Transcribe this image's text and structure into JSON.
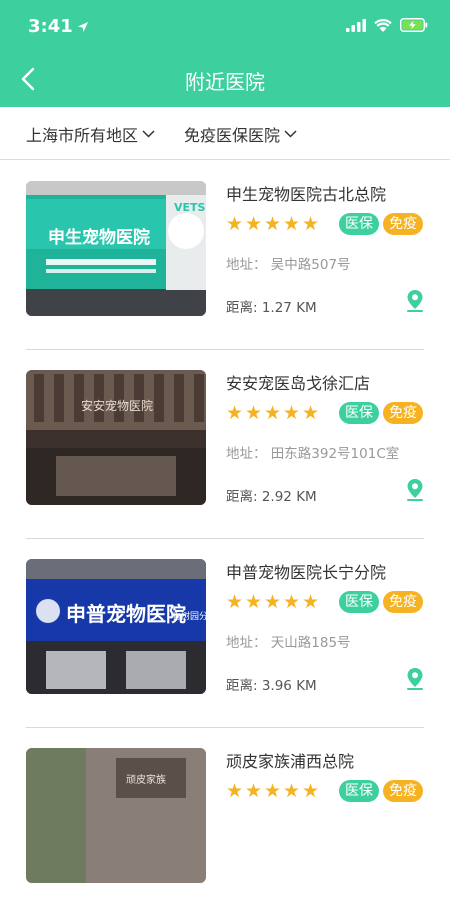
{
  "status_bar": {
    "time": "3:41"
  },
  "nav": {
    "title": "附近医院"
  },
  "filters": [
    {
      "label": "上海市所有地区"
    },
    {
      "label": "免疫医保医院"
    }
  ],
  "colors": {
    "accent": "#3ecf9f",
    "star": "#f5b324"
  },
  "hospitals": [
    {
      "name": "申生宠物医院古北总院",
      "rating": 5,
      "badges": [
        "医保",
        "免疫"
      ],
      "address": "地址：  吴中路507号",
      "distance": "距离: 1.27 KM",
      "sign_text": "申生宠物医院",
      "sign_text2": "VETS"
    },
    {
      "name": "安安宠医岛戈徐汇店",
      "rating": 5,
      "badges": [
        "医保",
        "免疫"
      ],
      "address": "地址：  田东路392号101C室",
      "distance": "距离: 2.92 KM",
      "sign_text": "安安宠物医院"
    },
    {
      "name": "申普宠物医院长宁分院",
      "rating": 5,
      "badges": [
        "医保",
        "免疫"
      ],
      "address": "地址：  天山路185号",
      "distance": "距离: 3.96 KM",
      "sign_text": "申普宠物医院",
      "sign_text2": "香树园分院"
    },
    {
      "name": "顽皮家族浦西总院",
      "rating": 5,
      "badges": [
        "医保",
        "免疫"
      ],
      "address": "",
      "distance": "",
      "sign_text": "顽皮家族"
    }
  ]
}
